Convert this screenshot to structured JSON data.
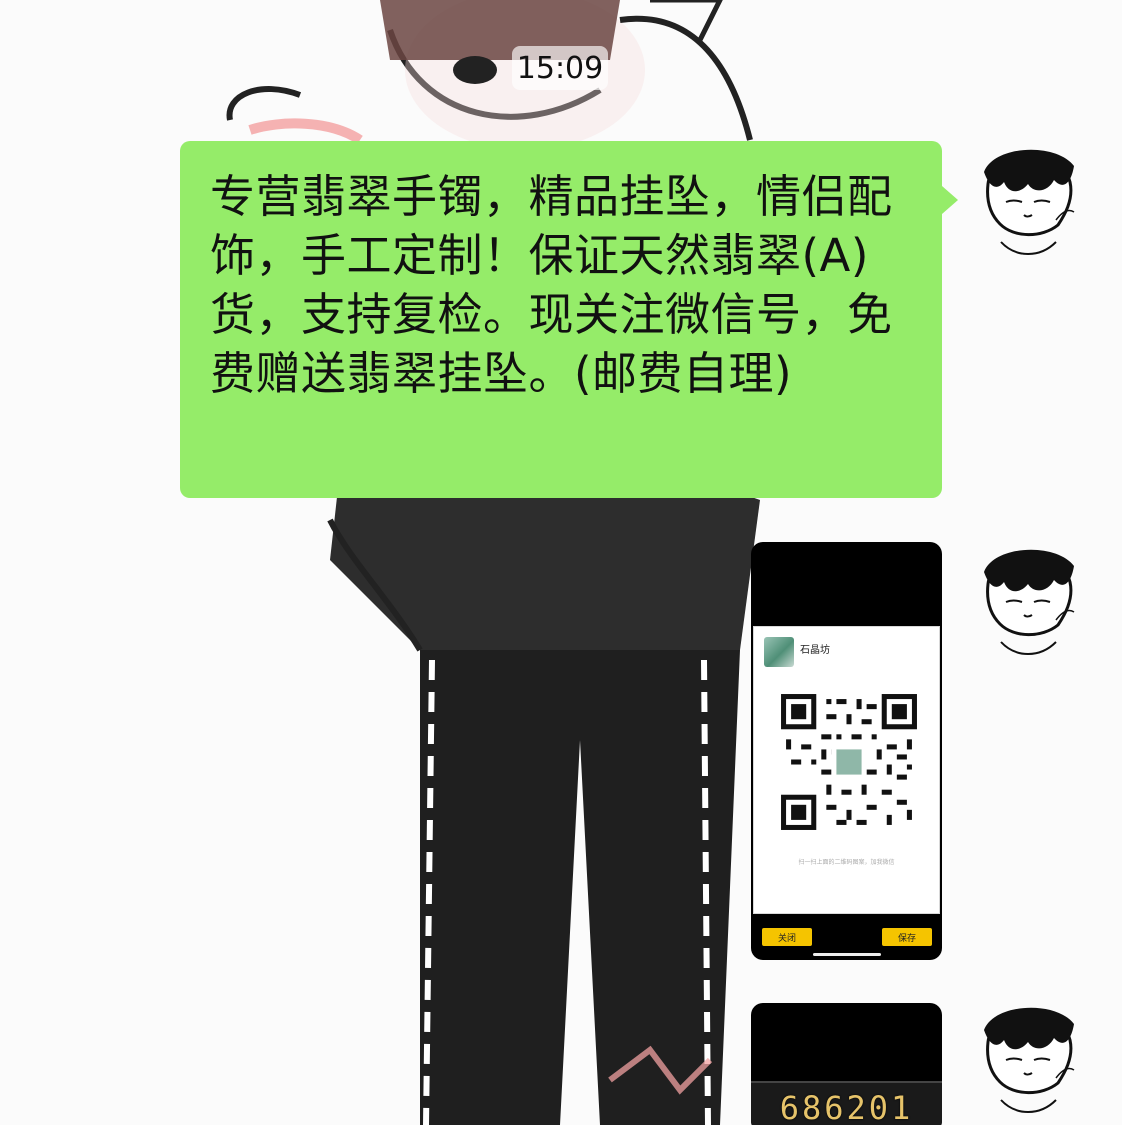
{
  "chat": {
    "timestamp": "15:09",
    "messages": [
      {
        "type": "text",
        "text": "专营翡翠手镯，精品挂坠，情侣配饰，手工定制！保证天然翡翠(A)货，支持复检。现关注微信号，免费赠送翡翠挂坠。(邮费自理)"
      },
      {
        "type": "image",
        "content": {
          "profile_name": "石晶坊",
          "hint": "扫一扫上面的二维码图案，加我微信",
          "buttons": {
            "close": "关闭",
            "save": "保存"
          }
        }
      },
      {
        "type": "image",
        "content": {
          "number": "686201"
        }
      }
    ]
  },
  "colors": {
    "bubble_green": "#95ec69",
    "button_yellow": "#f5c400"
  },
  "icons": {
    "avatar": "sketch-avatar-icon",
    "qr": "qr-code-icon"
  }
}
